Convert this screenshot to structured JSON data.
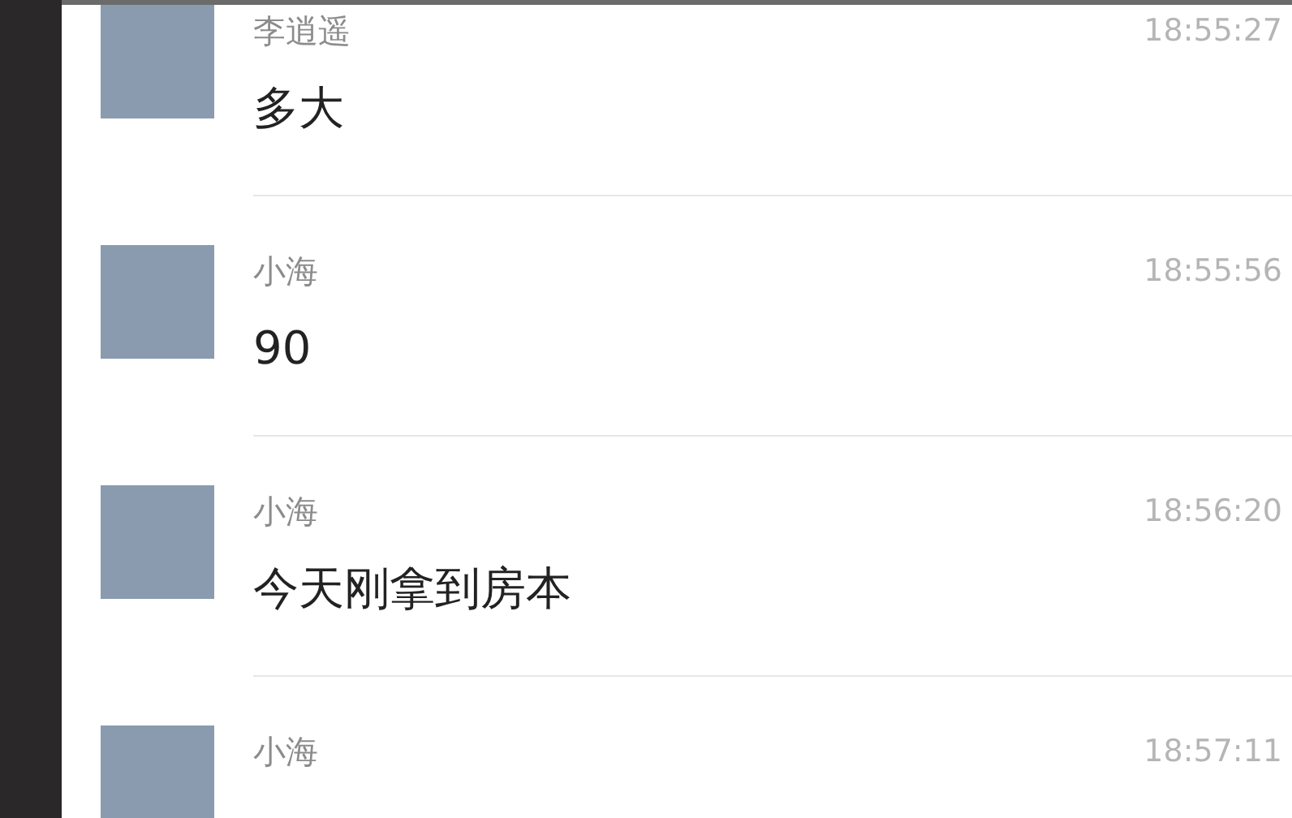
{
  "messages": [
    {
      "sender": "李逍遥",
      "time": "18:55:27",
      "text": "多大"
    },
    {
      "sender": "小海",
      "time": "18:55:56",
      "text": "90"
    },
    {
      "sender": "小海",
      "time": "18:56:20",
      "text": "今天刚拿到房本"
    },
    {
      "sender": "小海",
      "time": "18:57:11"
    }
  ]
}
